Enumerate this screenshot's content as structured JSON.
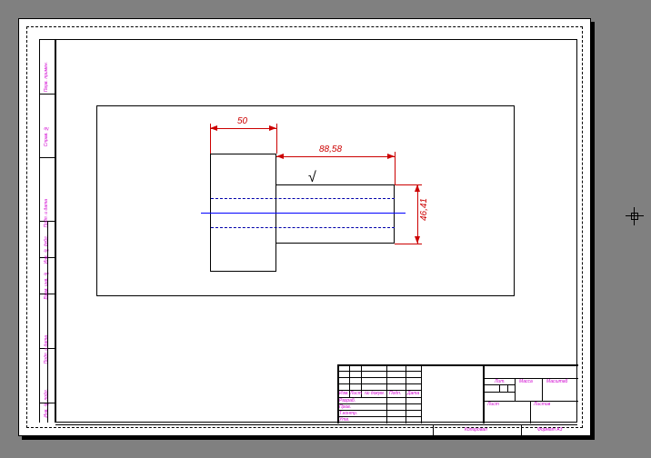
{
  "drawing": {
    "dimensions": {
      "width50": "50",
      "length88": "88,58",
      "diameter46": "46,41"
    },
    "surface_mark": "√"
  },
  "left_margin": {
    "l1": "Инв. № подл.",
    "l2": "Подп. и дата",
    "l3": "Взам. инв. №",
    "l4": "Инв. № дубл.",
    "l5": "Подп. и дата",
    "l6": "Справ. №",
    "l7": "Перв. примен."
  },
  "titleblock": {
    "row_labels": {
      "r1a": "Изм.",
      "r1b": "Лист",
      "r1c": "№ докум.",
      "r1d": "Подп.",
      "r1e": "Дата",
      "r2": "Разраб.",
      "r3": "Пров.",
      "r4": "Т.контр.",
      "r5": "Н.контр.",
      "r6": "Утв."
    },
    "right": {
      "lit": "Лит.",
      "massa": "Масса",
      "mashtab": "Масштаб",
      "list": "Лист",
      "listov": "Листов"
    },
    "bottom": {
      "kopiroval": "Копировал",
      "format": "Формат A3"
    }
  },
  "cursor": {
    "visible": true
  }
}
